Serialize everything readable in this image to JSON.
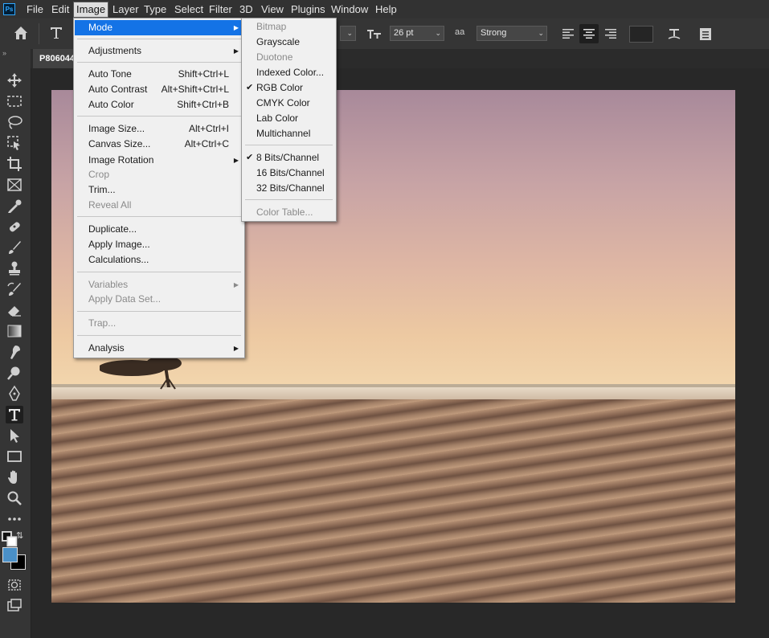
{
  "app": {
    "logo": "Ps"
  },
  "menubar": [
    "File",
    "Edit",
    "Image",
    "Layer",
    "Type",
    "Select",
    "Filter",
    "3D",
    "View",
    "Plugins",
    "Window",
    "Help"
  ],
  "options_bar": {
    "font_size": "26 pt",
    "anti_alias_icon": "aa",
    "anti_alias": "Strong",
    "icons": [
      "home-icon",
      "type-tool-icon",
      "font-size-icon",
      "align-left-icon",
      "align-center-icon",
      "align-right-icon",
      "text-color-swatch",
      "warp-text-icon",
      "character-panel-icon"
    ]
  },
  "document": {
    "tab_title": "P806044"
  },
  "image_menu": {
    "items": [
      {
        "label": "Mode",
        "submenu": true
      },
      {
        "label": "Adjustments",
        "submenu": true
      },
      {
        "label": "Auto Tone",
        "shortcut": "Shift+Ctrl+L"
      },
      {
        "label": "Auto Contrast",
        "shortcut": "Alt+Shift+Ctrl+L"
      },
      {
        "label": "Auto Color",
        "shortcut": "Shift+Ctrl+B"
      },
      {
        "label": "Image Size...",
        "shortcut": "Alt+Ctrl+I"
      },
      {
        "label": "Canvas Size...",
        "shortcut": "Alt+Ctrl+C"
      },
      {
        "label": "Image Rotation",
        "submenu": true
      },
      {
        "label": "Crop",
        "disabled": true
      },
      {
        "label": "Trim..."
      },
      {
        "label": "Reveal All",
        "disabled": true
      },
      {
        "label": "Duplicate..."
      },
      {
        "label": "Apply Image..."
      },
      {
        "label": "Calculations..."
      },
      {
        "label": "Variables",
        "submenu": true,
        "disabled": true
      },
      {
        "label": "Apply Data Set...",
        "disabled": true
      },
      {
        "label": "Trap...",
        "disabled": true
      },
      {
        "label": "Analysis",
        "submenu": true
      }
    ]
  },
  "mode_submenu": {
    "items": [
      {
        "label": "Bitmap",
        "disabled": true
      },
      {
        "label": "Grayscale"
      },
      {
        "label": "Duotone",
        "disabled": true
      },
      {
        "label": "Indexed Color..."
      },
      {
        "label": "RGB Color",
        "checked": true
      },
      {
        "label": "CMYK Color"
      },
      {
        "label": "Lab Color"
      },
      {
        "label": "Multichannel"
      },
      {
        "label": "8 Bits/Channel",
        "checked": true
      },
      {
        "label": "16 Bits/Channel"
      },
      {
        "label": "32 Bits/Channel"
      },
      {
        "label": "Color Table...",
        "disabled": true
      }
    ],
    "check_glyph": "✔"
  },
  "colors": {
    "foreground": "#4a90c8",
    "background": "#000000",
    "highlight": "#1473e6"
  }
}
